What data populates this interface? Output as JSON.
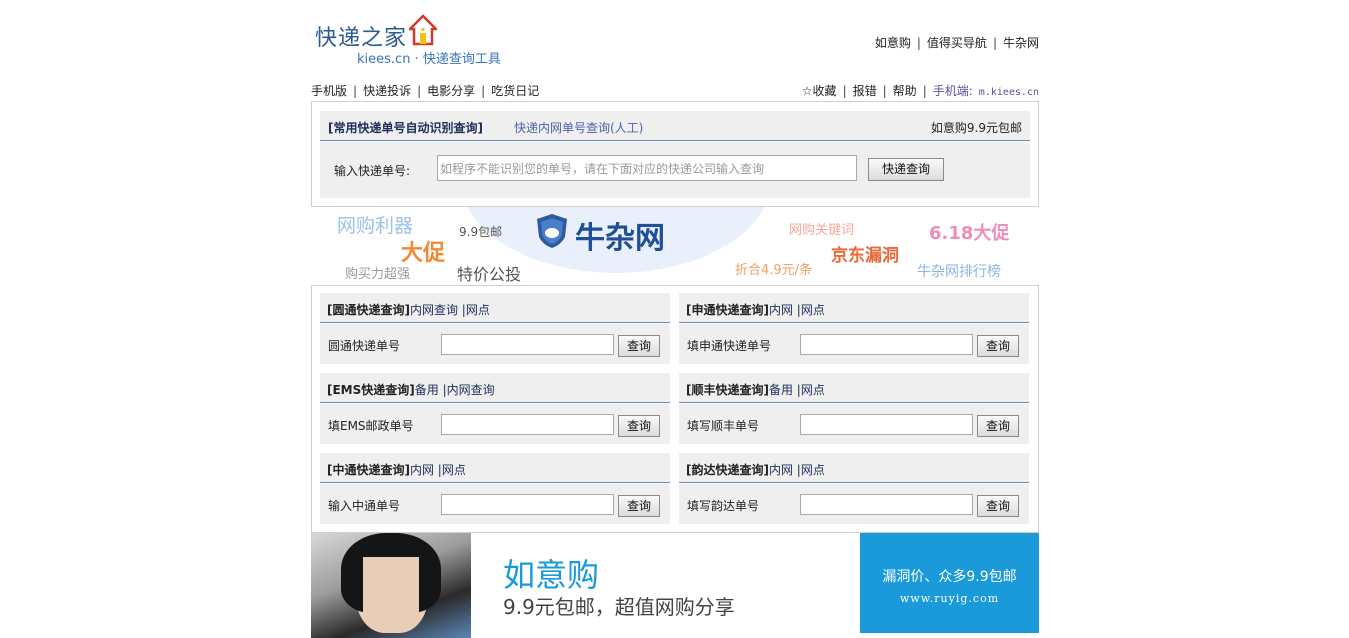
{
  "header": {
    "logo_text": "快递之家",
    "logo_subtitle": "kiees.cn · 快递查询工具",
    "top_links": [
      "如意购",
      "值得买导航",
      "牛杂网"
    ]
  },
  "nav": {
    "left": [
      "手机版",
      "快递投诉",
      "电影分享",
      "吃货日记"
    ],
    "right": [
      "☆收藏",
      "报错",
      "帮助"
    ],
    "mobile_label": "手机端:",
    "mobile_url": "m.kiees.cn"
  },
  "main_query": {
    "tab_active": "[常用快递单号自动识别查询]",
    "tab_manual": "快递内网单号查询(人工)",
    "promo": "如意购9.9元包邮",
    "label": "输入快递单号:",
    "placeholder": "如程序不能识别您的单号，请在下面对应的快递公司输入查询",
    "button": "快递查询"
  },
  "banner": {
    "brand": "牛杂网",
    "tags": [
      "网购利器",
      "大促",
      "9.9包邮",
      "购买力超强",
      "特价公投",
      "网购关键词",
      "京东漏洞",
      "6.18大促",
      "折合4.9元/条",
      "牛杂网排行榜"
    ]
  },
  "express": [
    {
      "name": "[圆通快递查询]",
      "links": "内网查询 |网点",
      "label": "圆通快递单号",
      "button": "查询"
    },
    {
      "name": "[申通快递查询]",
      "links": "内网 |网点",
      "label": "填申通快递单号",
      "button": "查询"
    },
    {
      "name": "[EMS快递查询]",
      "links": "备用 |内网查询",
      "label": "填EMS邮政单号",
      "button": "查询"
    },
    {
      "name": "[顺丰快递查询]",
      "links": "备用 |网点",
      "label": "填写顺丰单号",
      "button": "查询"
    },
    {
      "name": "[中通快递查询]",
      "links": "内网 |网点",
      "label": "输入中通单号",
      "button": "查询"
    },
    {
      "name": "[韵达快递查询]",
      "links": "内网 |网点",
      "label": "填写韵达单号",
      "button": "查询"
    }
  ],
  "ad": {
    "title": "如意购",
    "slogan": "9.9元包邮，超值网购分享",
    "side_line1": "漏洞价、众多9.9包邮",
    "side_url": "www.ruyig.com"
  },
  "colors": {
    "accent_blue": "#1a9ad8",
    "header_navy": "#1c2f58",
    "panel_gray": "#efefef"
  }
}
